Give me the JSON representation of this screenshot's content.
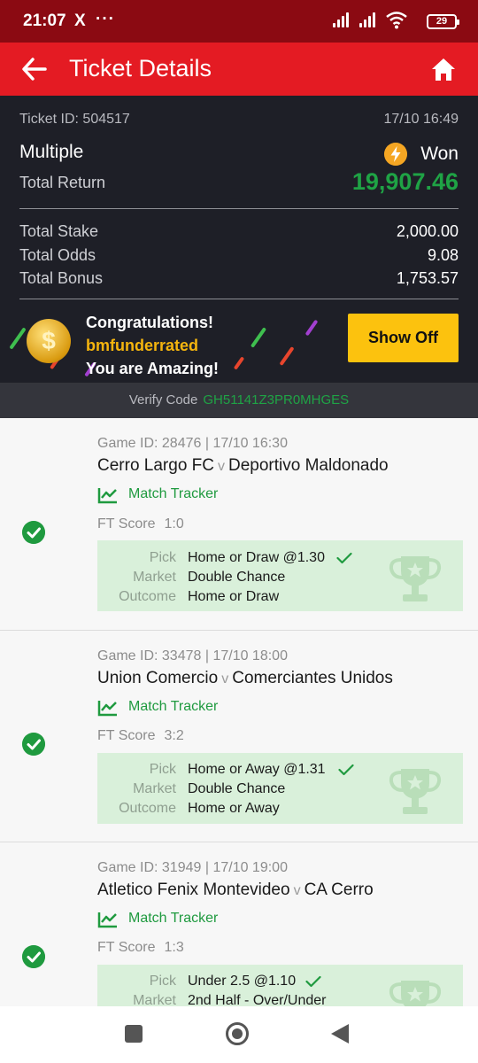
{
  "status_bar": {
    "time": "21:07",
    "x_icon": "X",
    "more": "···",
    "battery": "29"
  },
  "header": {
    "title": "Ticket Details",
    "back_icon": "arrow-left-icon",
    "home_icon": "home-icon"
  },
  "ticket": {
    "id_text": "Ticket ID: 504517",
    "datetime": "17/10 16:49",
    "type": "Multiple",
    "status": "Won",
    "total_return_label": "Total Return",
    "total_return": "19,907.46",
    "rows": [
      {
        "label": "Total Stake",
        "value": "2,000.00"
      },
      {
        "label": "Total Odds",
        "value": "9.08"
      },
      {
        "label": "Total Bonus",
        "value": "1,753.57"
      }
    ]
  },
  "promo": {
    "line1": "Congratulations!",
    "username": "bmfunderrated",
    "line3": "You are Amazing!",
    "coin_symbol": "$",
    "button": "Show Off"
  },
  "verify": {
    "label": "Verify Code",
    "code": "GH51141Z3PR0MHGES"
  },
  "games": [
    {
      "game_id": "Game ID: 28476 | 17/10 16:30",
      "home": "Cerro Largo FC",
      "vs": "v",
      "away": "Deportivo Maldonado",
      "tracker": "Match Tracker",
      "ft_label": "FT Score",
      "ft_score": "1:0",
      "pick_label": "Pick",
      "pick": "Home or Draw @1.30",
      "market_label": "Market",
      "market": "Double Chance",
      "outcome_label": "Outcome",
      "outcome": "Home or Draw"
    },
    {
      "game_id": "Game ID: 33478 | 17/10 18:00",
      "home": "Union Comercio",
      "vs": "v",
      "away": "Comerciantes Unidos",
      "tracker": "Match Tracker",
      "ft_label": "FT Score",
      "ft_score": "3:2",
      "pick_label": "Pick",
      "pick": "Home or Away @1.31",
      "market_label": "Market",
      "market": "Double Chance",
      "outcome_label": "Outcome",
      "outcome": "Home or Away"
    },
    {
      "game_id": "Game ID: 31949 | 17/10 19:00",
      "home": "Atletico Fenix Montevideo",
      "vs": "v",
      "away": "CA Cerro",
      "tracker": "Match Tracker",
      "ft_label": "FT Score",
      "ft_score": "1:3",
      "pick_label": "Pick",
      "pick": "Under 2.5 @1.10",
      "market_label": "Market",
      "market": "2nd Half - Over/Under"
    }
  ],
  "colors": {
    "brand_red": "#e41b23",
    "dark_red": "#8b0a12",
    "win_green": "#1fa345",
    "button_yellow": "#fcc20e",
    "summary_bg": "#1e1f27"
  }
}
